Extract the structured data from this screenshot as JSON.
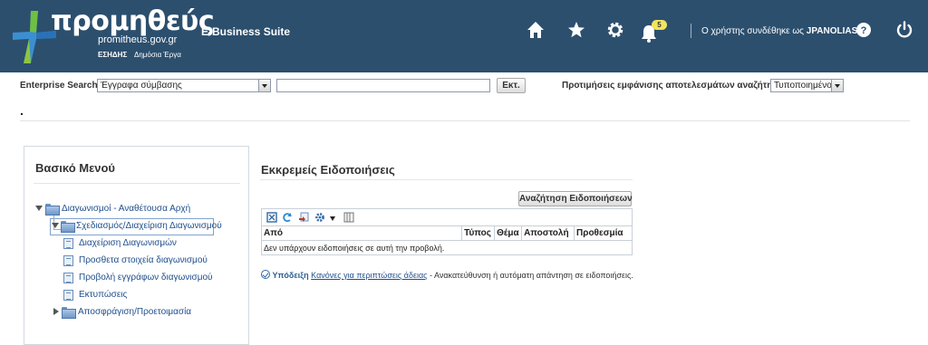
{
  "header": {
    "logo": {
      "wordmark": "προμηθεύς",
      "url": "promitheus.gov.gr",
      "sub_bold": "ΕΣΗΔΗΣ",
      "sub": "Δημόσια Έργα"
    },
    "app_title": "E-Business Suite",
    "icons": [
      "home-icon",
      "favorites-star-icon",
      "settings-gear-icon",
      "notifications-bell-icon",
      "help-icon",
      "logout-power-icon"
    ],
    "notification_count": "5",
    "user_prefix": "Ο χρήστης συνδέθηκε ως",
    "user_name": "JPANOLIAS",
    "colors": {
      "header_bg": "#2c4f6e",
      "badge": "#f2e45c"
    }
  },
  "search": {
    "label": "Enterprise Search",
    "scope_value": "Έγγραφα σύμβασης",
    "query_value": "",
    "go_label": "Εκτ.",
    "prefs_label": "Προτιμήσεις εμφάνισης αποτελεσμάτων αναζήτησης",
    "prefs_value": "Τυποποιημένο"
  },
  "misc": {
    "dot": "."
  },
  "menu": {
    "title": "Βασικό Μενού",
    "items": [
      {
        "label": "Διαγωνισμοί - Αναθέτουσα Αρχή",
        "icon": "folder-icon",
        "expanded": true
      },
      {
        "label": "Σχεδιασμός/Διαχείριση Διαγωνισμού",
        "icon": "folder-icon",
        "expanded": true,
        "selected": true
      },
      {
        "label": "Διαχείριση Διαγωνισμών",
        "icon": "document-icon"
      },
      {
        "label": "Προσθετα στοιχεία διαγωνισμού",
        "icon": "document-icon"
      },
      {
        "label": "Προβολή εγγράφων διαγωνισμού",
        "icon": "document-icon"
      },
      {
        "label": "Εκτυπώσεις",
        "icon": "document-icon"
      },
      {
        "label": "Αποσφράγιση/Προετοιμασία",
        "icon": "folder-icon",
        "expanded": false
      }
    ]
  },
  "notifications": {
    "title": "Εκκρεμείς Ειδοποιήσεις",
    "search_button": "Αναζήτηση Ειδοποιήσεων",
    "toolbar_icons": [
      "detach-icon",
      "refresh-icon",
      "export-icon",
      "view-settings-icon",
      "columns-icon"
    ],
    "columns": [
      "Από",
      "Τύπος",
      "Θέμα",
      "Αποστολή",
      "Προθεσμία"
    ],
    "empty_message": "Δεν υπάρχουν ειδοποιήσεις σε αυτή την προβολή.",
    "tip_label": "Υπόδειξη",
    "tip_link": "Κανόνες για περιπτώσεις άδειας",
    "tip_text": " - Ανακατεύθυνση ή αυτόματη απάντηση σε ειδοποιήσεις."
  }
}
